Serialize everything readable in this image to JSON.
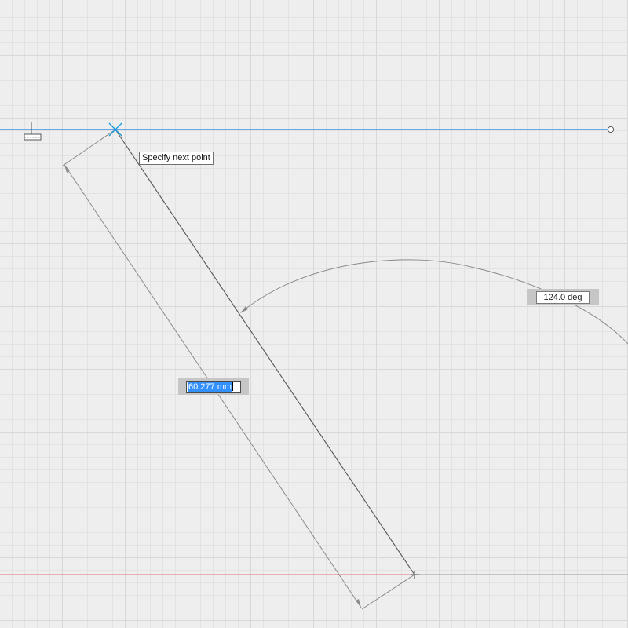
{
  "tooltip": {
    "text": "Specify next point"
  },
  "angle_dimension": {
    "value": "124.0 deg"
  },
  "length_dimension": {
    "value": "60.277 mm"
  },
  "colors": {
    "background": "#eeeeee",
    "grid_major": "#d8d8d8",
    "grid_minor": "#e2e2e2",
    "x_axis": "#e07070",
    "y_constraint_line": "#1f7fe0",
    "sketch_line": "#555555",
    "dimension_line": "#8a8a8a",
    "cursor": "#1a9be0",
    "text_selection": "#3390ff"
  },
  "icons": {
    "horizontal_constraint": "horizontal-constraint-icon",
    "cursor": "crosshair-cursor-icon",
    "line_endpoint": "line-endpoint-icon",
    "arrowhead": "arrowhead-icon"
  }
}
